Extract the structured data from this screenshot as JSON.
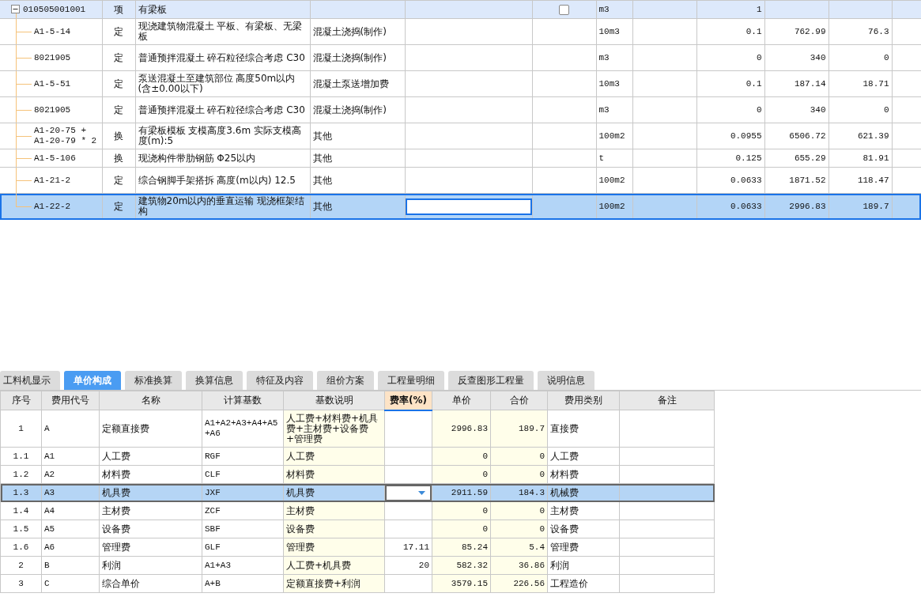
{
  "top_grid": {
    "rows": [
      {
        "kind": "group",
        "code": "010505001001",
        "type": "项",
        "name": "有梁板",
        "category": "",
        "unit": "m3",
        "quantity": "1",
        "unit_price": "",
        "total": "",
        "expanded": true,
        "checked": false,
        "selected": false
      },
      {
        "kind": "item",
        "code": "A1-5-14",
        "type": "定",
        "name": "现浇建筑物混凝土 平板、有梁板、无梁板",
        "category": "混凝土浇捣(制作)",
        "unit": "10m3",
        "quantity": "0.1",
        "unit_price": "762.99",
        "total": "76.3",
        "selected": false
      },
      {
        "kind": "item",
        "code": "8021905",
        "type": "定",
        "name": "普通预拌混凝土 碎石粒径综合考虑 C30",
        "category": "混凝土浇捣(制作)",
        "unit": "m3",
        "quantity": "0",
        "unit_price": "340",
        "total": "0",
        "selected": false
      },
      {
        "kind": "item",
        "code": "A1-5-51",
        "type": "定",
        "name": "泵送混凝土至建筑部位 高度50m以内(含±0.00以下)",
        "category": "混凝土泵送增加费",
        "unit": "10m3",
        "quantity": "0.1",
        "unit_price": "187.14",
        "total": "18.71",
        "selected": false
      },
      {
        "kind": "item",
        "code": "8021905",
        "type": "定",
        "name": "普通预拌混凝土 碎石粒径综合考虑 C30",
        "category": "混凝土浇捣(制作)",
        "unit": "m3",
        "quantity": "0",
        "unit_price": "340",
        "total": "0",
        "selected": false
      },
      {
        "kind": "item",
        "code": "A1-20-75 + A1-20-79 * 2",
        "type": "换",
        "name": "有梁板模板 支模高度3.6m  实际支模高度(m):5",
        "category": "其他",
        "unit": "100m2",
        "quantity": "0.0955",
        "unit_price": "6506.72",
        "total": "621.39",
        "selected": false
      },
      {
        "kind": "item",
        "code": "A1-5-106",
        "type": "换",
        "name": "现浇构件带肋钢筋 Φ25以内",
        "category": "其他",
        "unit": "t",
        "quantity": "0.125",
        "unit_price": "655.29",
        "total": "81.91",
        "selected": false
      },
      {
        "kind": "item",
        "code": "A1-21-2",
        "type": "定",
        "name": "综合钢脚手架搭拆 高度(m以内) 12.5",
        "category": "其他",
        "unit": "100m2",
        "quantity": "0.0633",
        "unit_price": "1871.52",
        "total": "118.47",
        "selected": false
      },
      {
        "kind": "item",
        "code": "A1-22-2",
        "type": "定",
        "name": "建筑物20m以内的垂直运输 现浇框架结构",
        "category": "其他",
        "unit": "100m2",
        "quantity": "0.0633",
        "unit_price": "2996.83",
        "total": "189.7",
        "selected": true
      }
    ]
  },
  "bottom_panel": {
    "tabs": [
      {
        "label": "工料机显示",
        "selected": false
      },
      {
        "label": "单价构成",
        "selected": true
      },
      {
        "label": "标准换算",
        "selected": false
      },
      {
        "label": "换算信息",
        "selected": false
      },
      {
        "label": "特征及内容",
        "selected": false
      },
      {
        "label": "组价方案",
        "selected": false
      },
      {
        "label": "工程量明细",
        "selected": false
      },
      {
        "label": "反查图形工程量",
        "selected": false
      },
      {
        "label": "说明信息",
        "selected": false
      }
    ],
    "columns": [
      "序号",
      "费用代号",
      "名称",
      "计算基数",
      "基数说明",
      "费率(%)",
      "单价",
      "合价",
      "费用类别",
      "备注"
    ],
    "rows": [
      {
        "no": "1",
        "code": "A",
        "name": "定额直接费",
        "base": "A1+A2+A3+A4+A5+A6",
        "base_desc": "人工费+材料费+机具费+主材费+设备费+管理费",
        "rate": "",
        "unit_price": "2996.83",
        "total": "189.7",
        "category": "直接费",
        "selected": false
      },
      {
        "no": "1.1",
        "code": "A1",
        "name": "人工费",
        "base": "RGF",
        "base_desc": "人工费",
        "rate": "",
        "unit_price": "0",
        "total": "0",
        "category": "人工费",
        "selected": false
      },
      {
        "no": "1.2",
        "code": "A2",
        "name": "材料费",
        "base": "CLF",
        "base_desc": "材料费",
        "rate": "",
        "unit_price": "0",
        "total": "0",
        "category": "材料费",
        "selected": false
      },
      {
        "no": "1.3",
        "code": "A3",
        "name": "机具费",
        "base": "JXF",
        "base_desc": "机具费",
        "rate": "",
        "unit_price": "2911.59",
        "total": "184.3",
        "category": "机械费",
        "selected": true
      },
      {
        "no": "1.4",
        "code": "A4",
        "name": "主材费",
        "base": "ZCF",
        "base_desc": "主材费",
        "rate": "",
        "unit_price": "0",
        "total": "0",
        "category": "主材费",
        "selected": false
      },
      {
        "no": "1.5",
        "code": "A5",
        "name": "设备费",
        "base": "SBF",
        "base_desc": "设备费",
        "rate": "",
        "unit_price": "0",
        "total": "0",
        "category": "设备费",
        "selected": false
      },
      {
        "no": "1.6",
        "code": "A6",
        "name": "管理费",
        "base": "GLF",
        "base_desc": "管理费",
        "rate": "17.11",
        "unit_price": "85.24",
        "total": "5.4",
        "category": "管理费",
        "selected": false
      },
      {
        "no": "2",
        "code": "B",
        "name": "利润",
        "base": "A1+A3",
        "base_desc": "人工费+机具费",
        "rate": "20",
        "unit_price": "582.32",
        "total": "36.86",
        "category": "利润",
        "selected": false
      },
      {
        "no": "3",
        "code": "C",
        "name": "综合单价",
        "base": "A+B",
        "base_desc": "定额直接费+利润",
        "rate": "",
        "unit_price": "3579.15",
        "total": "226.56",
        "category": "工程造价",
        "selected": false
      }
    ]
  }
}
